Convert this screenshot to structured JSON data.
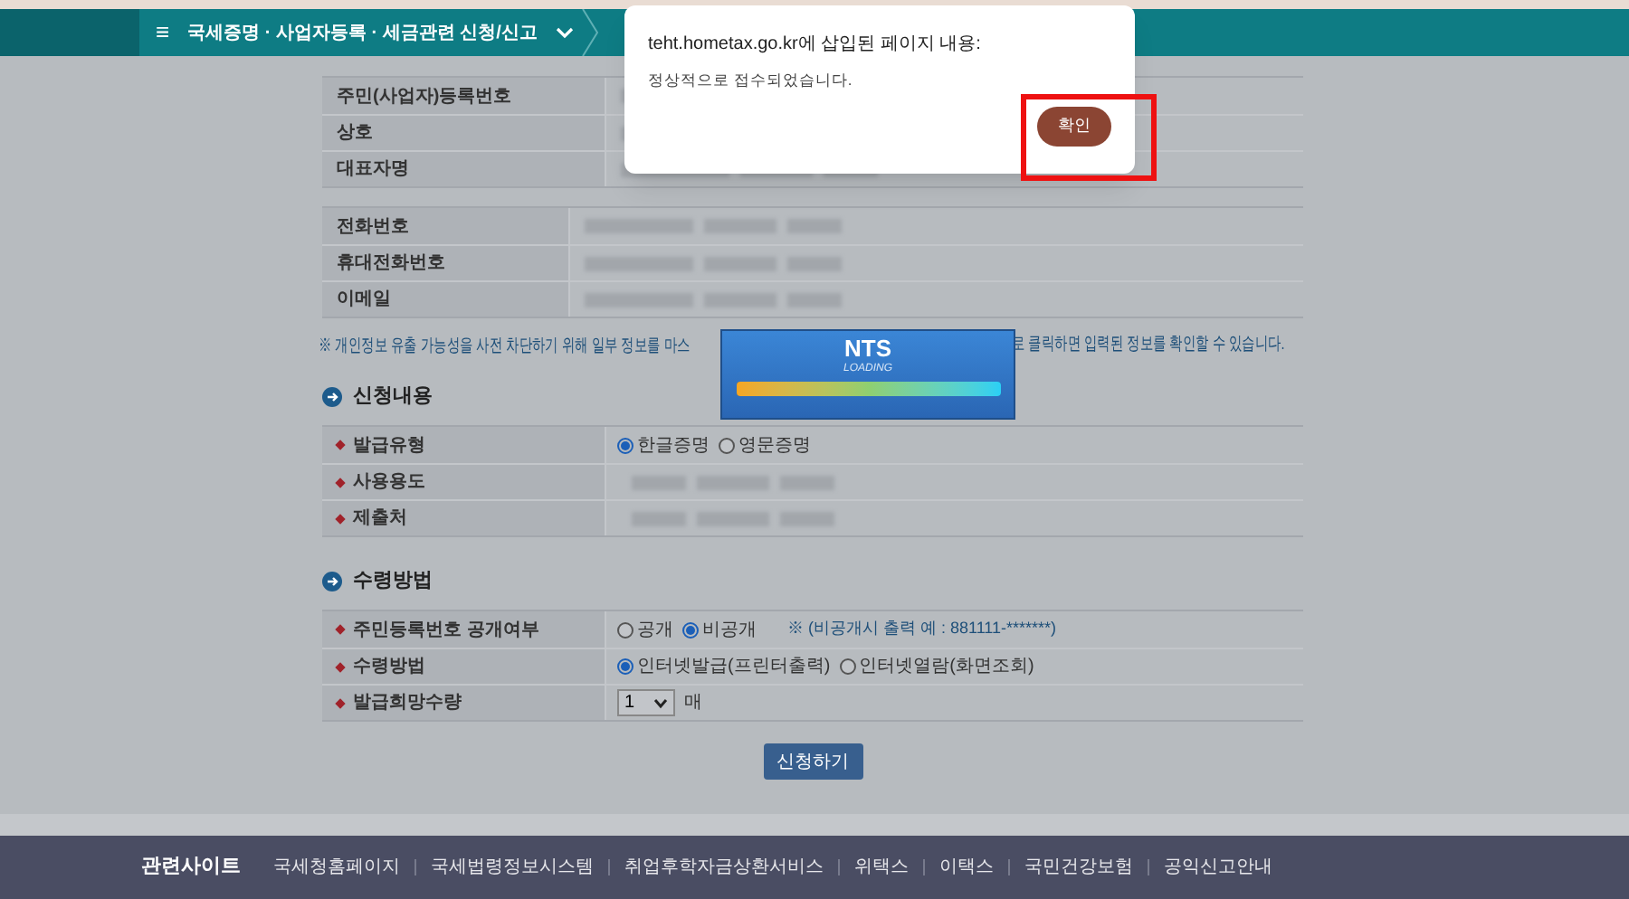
{
  "nav": {
    "menu_icon": "≡",
    "title": "국세증명 · 사업자등록 · 세금관련 신청/신고"
  },
  "applicant": {
    "group_1": [
      {
        "label": "주민(사업자)등록번호"
      },
      {
        "label": "상호"
      },
      {
        "label": "대표자명"
      }
    ],
    "group_2": [
      {
        "label": "전화번호"
      },
      {
        "label": "휴대전화번호"
      },
      {
        "label": "이메일"
      }
    ],
    "note_parts": [
      "※ 개인정보 유출 가능성을 사전 차단하기 위해 일부 정보를 마스",
      "로 클릭하면 입력된 정보를 확인할 수 있습니다."
    ]
  },
  "sections": [
    {
      "title": "신청내용",
      "rows": [
        {
          "label": "발급유형",
          "required": true,
          "kind": "radio",
          "options": [
            {
              "label": "한글증명",
              "selected": true
            },
            {
              "label": "영문증명",
              "selected": false
            }
          ]
        },
        {
          "label": "사용용도",
          "required": true,
          "kind": "masked"
        },
        {
          "label": "제출처",
          "required": true,
          "kind": "masked"
        }
      ]
    },
    {
      "title": "수령방법",
      "rows": [
        {
          "label": "주민등록번호 공개여부",
          "required": true,
          "kind": "radio",
          "options": [
            {
              "label": "공개",
              "selected": false
            },
            {
              "label": "비공개",
              "selected": true
            }
          ],
          "note": "※ (비공개시 출력 예 : 881111-*******)"
        },
        {
          "label": "수령방법",
          "required": true,
          "kind": "radio",
          "options": [
            {
              "label": "인터넷발급(프린터출력)",
              "selected": true
            },
            {
              "label": "인터넷열람(화면조회)",
              "selected": false
            }
          ]
        },
        {
          "label": "발급희망수량",
          "required": true,
          "kind": "select",
          "value": "1",
          "unit": "매"
        }
      ]
    }
  ],
  "submit_button": "신청하기",
  "footer": {
    "heading": "관련사이트",
    "links": [
      "국세청홈페이지",
      "국세법령정보시스템",
      "취업후학자금상환서비스",
      "위택스",
      "이택스",
      "국민건강보험",
      "공익신고안내"
    ]
  },
  "loading": {
    "title": "NTS",
    "subtitle": "LOADING",
    "level": 1
  },
  "dialog": {
    "title": "teht.hometax.go.kr에 삽입된 페이지 내용:",
    "message": "정상적으로 접수되었습니다.",
    "ok_button": "확인",
    "highlighted": true
  }
}
